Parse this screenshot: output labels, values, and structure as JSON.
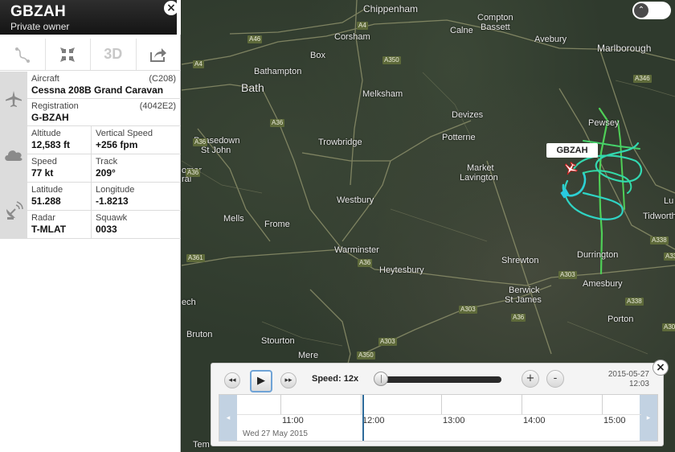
{
  "flight": {
    "callsign": "GBZAH",
    "owner": "Private owner",
    "label": "GBZAH"
  },
  "toolbar": {
    "route_icon": "route-icon",
    "collapse_icon": "collapse-icon",
    "view3d_label": "3D",
    "share_icon": "share-icon"
  },
  "details": {
    "aircraft": {
      "label": "Aircraft",
      "value": "Cessna 208B Grand Caravan",
      "code": "(C208)"
    },
    "registration": {
      "label": "Registration",
      "value": "G-BZAH",
      "code": "(4042E2)"
    },
    "altitude": {
      "label": "Altitude",
      "value": "12,583 ft"
    },
    "vertical_speed": {
      "label": "Vertical Speed",
      "value": "+256 fpm"
    },
    "speed": {
      "label": "Speed",
      "value": "77 kt"
    },
    "track": {
      "label": "Track",
      "value": "209°"
    },
    "latitude": {
      "label": "Latitude",
      "value": "51.288"
    },
    "longitude": {
      "label": "Longitude",
      "value": "-1.8213"
    },
    "radar": {
      "label": "Radar",
      "value": "T-MLAT"
    },
    "squawk": {
      "label": "Squawk",
      "value": "0033"
    }
  },
  "map": {
    "towns": {
      "chippenham": "Chippenham",
      "corsham": "Corsham",
      "calne": "Calne",
      "compton": "Compton",
      "bassett": "Bassett",
      "avebury": "Avebury",
      "marlborough": "Marlborough",
      "box": "Box",
      "bathampton": "Bathampton",
      "bath": "Bath",
      "melksham": "Melksham",
      "devizes": "Devizes",
      "pewsey": "Pewsey",
      "peasedown": "Peasedown",
      "stjohn": "St John",
      "trowbridge": "Trowbridge",
      "potterne": "Potterne",
      "market": "Market",
      "lavington": "Lavington",
      "omer": "omer",
      "ral": "ral",
      "westbury": "Westbury",
      "tidworth": "Tidworth",
      "lu": "Lu",
      "mells": "Mells",
      "frome": "Frome",
      "warminster": "Warminster",
      "heytesbury": "Heytesbury",
      "shrewton": "Shrewton",
      "durrington": "Durrington",
      "amesbury": "Amesbury",
      "berwick": "Berwick",
      "stjames": "St James",
      "ech": "ech",
      "porton": "Porton",
      "bruton": "Bruton",
      "stourton": "Stourton",
      "mere": "Mere",
      "tem": "Tem"
    },
    "roads": [
      "A4",
      "A46",
      "A350",
      "A4",
      "A346",
      "A36",
      "A36",
      "A361",
      "A36",
      "A303",
      "A303",
      "A36",
      "A303",
      "A350",
      "A338",
      "A338",
      "A338",
      "A303",
      "A36"
    ]
  },
  "playback": {
    "rewind_icon": "◂◂",
    "play_icon": "▶",
    "forward_icon": "▸▸",
    "speed_label": "Speed: 12x",
    "speed_fraction": 0.0,
    "zoom_in": "+",
    "zoom_out": "-",
    "date": "2015-05-27",
    "time": "12:03",
    "timeline_date": "Wed 27 May 2015",
    "ticks": [
      "11:00",
      "12:00",
      "13:00",
      "14:00",
      "15:00"
    ]
  },
  "controls": {
    "close_icon": "×",
    "zoom_up_icon": "⌃"
  }
}
